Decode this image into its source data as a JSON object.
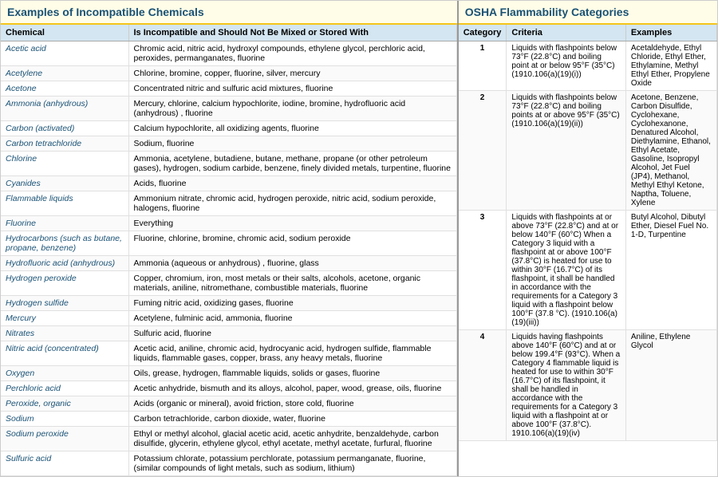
{
  "left": {
    "title": "Examples of Incompatible Chemicals",
    "col1": "Chemical",
    "col2": "Is Incompatible and Should Not Be Mixed or Stored With",
    "rows": [
      [
        "Acetic acid",
        "Chromic acid, nitric acid, hydroxyl compounds, ethylene glycol, perchloric acid, peroxides, permanganates, fluorine"
      ],
      [
        "Acetylene",
        "Chlorine, bromine, copper, fluorine, silver, mercury"
      ],
      [
        "Acetone",
        "Concentrated nitric and sulfuric acid mixtures, fluorine"
      ],
      [
        "Ammonia (anhydrous)",
        "Mercury, chlorine, calcium hypochlorite, iodine, bromine, hydrofluoric acid (anhydrous) , fluorine"
      ],
      [
        "Carbon (activated)",
        "Calcium hypochlorite, all oxidizing agents, fluorine"
      ],
      [
        "Carbon tetrachloride",
        "Sodium, fluorine"
      ],
      [
        "Chlorine",
        "Ammonia, acetylene, butadiene, butane, methane, propane (or other petroleum gases), hydrogen, sodium carbide, benzene, finely divided metals, turpentine, fluorine"
      ],
      [
        "Cyanides",
        "Acids, fluorine"
      ],
      [
        "Flammable liquids",
        "Ammonium nitrate, chromic acid, hydrogen peroxide, nitric acid, sodium peroxide, halogens, fluorine"
      ],
      [
        "Fluorine",
        "Everything"
      ],
      [
        "Hydrocarbons (such as butane, propane, benzene)",
        "Fluorine, chlorine, bromine, chromic acid, sodium peroxide"
      ],
      [
        "Hydrofluoric acid (anhydrous)",
        "Ammonia (aqueous or anhydrous) , fluorine, glass"
      ],
      [
        "Hydrogen peroxide",
        "Copper, chromium, iron, most metals or their salts, alcohols, acetone, organic materials, aniline, nitromethane, combustible materials, fluorine"
      ],
      [
        "Hydrogen sulfide",
        "Fuming nitric acid, oxidizing gases, fluorine"
      ],
      [
        "Mercury",
        "Acetylene, fulminic acid, ammonia, fluorine"
      ],
      [
        "Nitrates",
        "Sulfuric acid, fluorine"
      ],
      [
        "Nitric acid (concentrated)",
        "Acetic acid, aniline, chromic acid, hydrocyanic acid, hydrogen sulfide, flammable liquids, flammable gases, copper, brass, any heavy metals, fluorine"
      ],
      [
        "Oxygen",
        "Oils, grease, hydrogen, flammable liquids, solids or gases, fluorine"
      ],
      [
        "Perchloric acid",
        "Acetic anhydride, bismuth and its alloys, alcohol, paper, wood, grease, oils, fluorine"
      ],
      [
        "Peroxide, organic",
        "Acids (organic or mineral), avoid friction, store cold, fluorine"
      ],
      [
        "Sodium",
        "Carbon tetrachloride, carbon dioxide, water, fluorine"
      ],
      [
        "Sodium peroxide",
        "Ethyl or methyl alcohol, glacial acetic acid, acetic anhydrite, benzaldehyde, carbon disulfide, glycerin, ethylene glycol, ethyl acetate, methyl acetate, furfural, fluorine"
      ],
      [
        "Sulfuric acid",
        "Potassium chlorate, potassium perchlorate, potassium permanganate, fluorine, (similar compounds of light metals, such as sodium, lithium)"
      ]
    ]
  },
  "right": {
    "title": "OSHA Flammability Categories",
    "col1": "Category",
    "col2": "Criteria",
    "col3": "Examples",
    "rows": [
      [
        "1",
        "Liquids with flashpoints below 73°F (22.8°C) and boiling point at or below 95°F (35°C) (1910.106(a)(19)(i))",
        "Acetaldehyde, Ethyl Chloride, Ethyl Ether, Ethylamine, Methyl Ethyl Ether, Propylene Oxide"
      ],
      [
        "2",
        "Liquids with flashpoints below 73°F (22.8°C) and boiling points at or above 95°F (35°C) (1910.106(a)(19)(ii))",
        "Acetone, Benzene, Carbon Disulfide, Cyclohexane, Cyclohexanone, Denatured Alcohol, Diethylamine, Ethanol, Ethyl Acetate, Gasoline, Isopropyl Alcohol, Jet Fuel (JP4), Methanol, Methyl Ethyl Ketone, Naptha, Toluene, Xylene"
      ],
      [
        "3",
        "Liquids with flashpoints at or above 73°F (22.8°C) and at or below 140°F (60°C) When a Category 3 liquid with a flashpoint at or above 100°F (37.8°C) is heated for use to within 30°F (16.7°C) of its flashpoint, it shall be handled in accordance with the requirements for a Category 3 liquid with a flashpoint below 100°F (37.8 °C). (1910.106(a)(19)(iii))",
        "Butyl Alcohol, Dibutyl Ether, Diesel Fuel No. 1-D, Turpentine"
      ],
      [
        "4",
        "Liquids having flashpoints above 140°F (60°C) and at or below 199.4°F (93°C). When a Category 4 flammable liquid is heated for use to within 30°F (16.7°C) of its flashpoint, it shall be handled in accordance with the requirements for a Category 3 liquid with a flashpoint at or above 100°F (37.8°C). 1910.106(a)(19)(iv)",
        "Aniline, Ethylene Glycol"
      ]
    ]
  }
}
